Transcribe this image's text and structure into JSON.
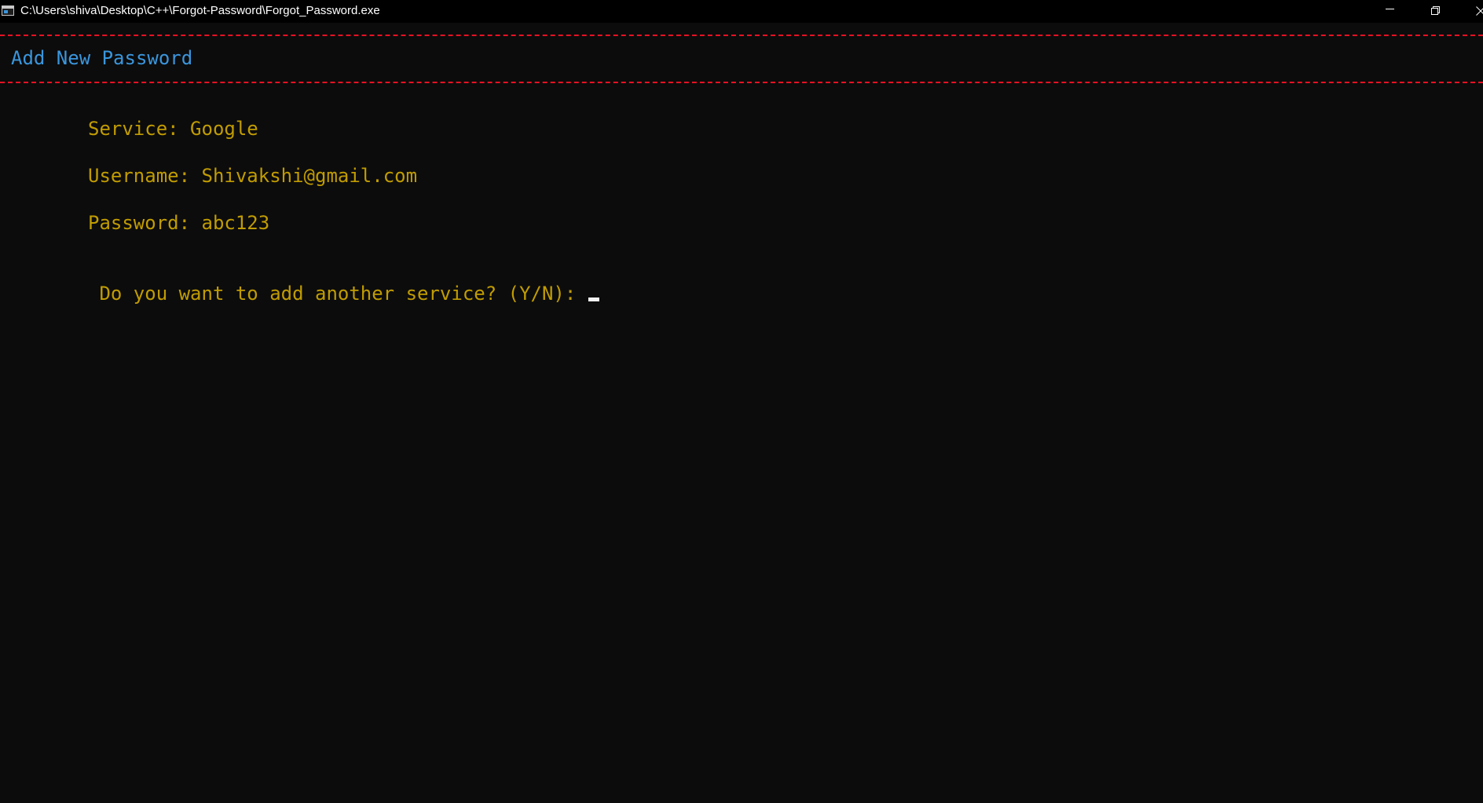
{
  "window": {
    "title": "C:\\Users\\shiva\\Desktop\\C++\\Forgot-Password\\Forgot_Password.exe"
  },
  "console": {
    "heading": "Add New Password",
    "fields": [
      {
        "label": "Service:",
        "value": "Google"
      },
      {
        "label": "Username:",
        "value": "Shivakshi@gmail.com"
      },
      {
        "label": "Password:",
        "value": "abc123"
      }
    ],
    "prompt": "Do you want to add another service? (Y/N):",
    "input_value": ""
  },
  "colors": {
    "background": "#0c0c0c",
    "heading": "#3a96dd",
    "text": "#c19c00",
    "divider": "#e81123",
    "cursor": "#f2f2f2"
  }
}
